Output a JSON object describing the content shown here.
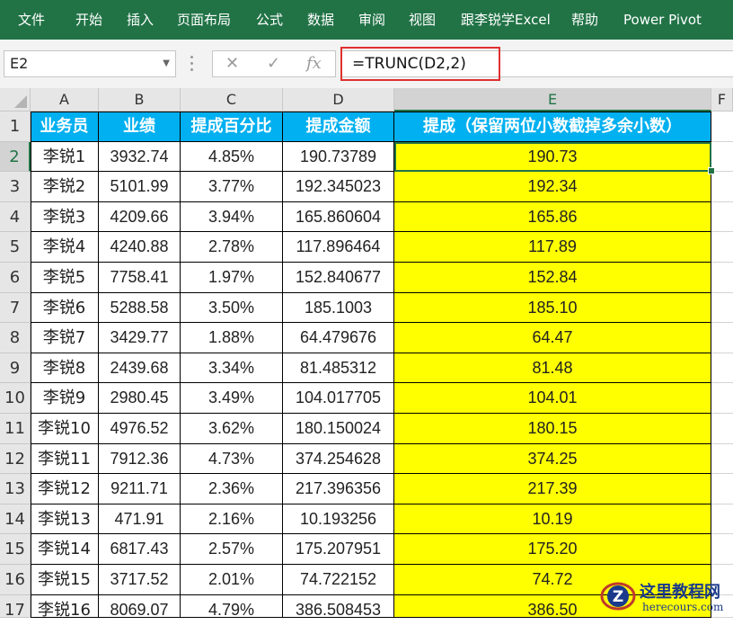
{
  "ribbon": {
    "tabs": [
      "文件",
      "开始",
      "插入",
      "页面布局",
      "公式",
      "数据",
      "审阅",
      "视图",
      "跟李锐学Excel",
      "帮助",
      "Power Pivot"
    ],
    "color": "#217346"
  },
  "formula_bar": {
    "name_box": "E2",
    "cancel_icon": "✕",
    "enter_icon": "✓",
    "fx_label": "fx",
    "formula": "=TRUNC(D2,2)"
  },
  "sheet": {
    "columns": [
      "A",
      "B",
      "C",
      "D",
      "E",
      "F"
    ],
    "row_numbers": [
      "1",
      "2",
      "3",
      "4",
      "5",
      "6",
      "7",
      "8",
      "9",
      "10",
      "11",
      "12",
      "13",
      "14",
      "15",
      "16",
      "17"
    ],
    "header_row": [
      "业务员",
      "业绩",
      "提成百分比",
      "提成金额",
      "提成（保留两位小数截掉多余小数）"
    ],
    "rows": [
      [
        "李锐1",
        "3932.74",
        "4.85%",
        "190.73789",
        "190.73"
      ],
      [
        "李锐2",
        "5101.99",
        "3.77%",
        "192.345023",
        "192.34"
      ],
      [
        "李锐3",
        "4209.66",
        "3.94%",
        "165.860604",
        "165.86"
      ],
      [
        "李锐4",
        "4240.88",
        "2.78%",
        "117.896464",
        "117.89"
      ],
      [
        "李锐5",
        "7758.41",
        "1.97%",
        "152.840677",
        "152.84"
      ],
      [
        "李锐6",
        "5288.58",
        "3.50%",
        "185.1003",
        "185.10"
      ],
      [
        "李锐7",
        "3429.77",
        "1.88%",
        "64.479676",
        "64.47"
      ],
      [
        "李锐8",
        "2439.68",
        "3.34%",
        "81.485312",
        "81.48"
      ],
      [
        "李锐9",
        "2980.45",
        "3.49%",
        "104.017705",
        "104.01"
      ],
      [
        "李锐10",
        "4976.52",
        "3.62%",
        "180.150024",
        "180.15"
      ],
      [
        "李锐11",
        "7912.36",
        "4.73%",
        "374.254628",
        "374.25"
      ],
      [
        "李锐12",
        "9211.71",
        "2.36%",
        "217.396356",
        "217.39"
      ],
      [
        "李锐13",
        "471.91",
        "2.16%",
        "10.193256",
        "10.19"
      ],
      [
        "李锐14",
        "6817.43",
        "2.57%",
        "175.207951",
        "175.20"
      ],
      [
        "李锐15",
        "3717.52",
        "2.01%",
        "74.722152",
        "74.72"
      ],
      [
        "李锐16",
        "8069.07",
        "4.79%",
        "386.508453",
        "386.50"
      ]
    ],
    "header_fill": "#00b0f0",
    "highlight_fill": "#ffff00",
    "active_cell": "E2"
  },
  "watermark": {
    "title": "这里教程网",
    "url": "herecours.com",
    "logo_letter": "Z"
  }
}
